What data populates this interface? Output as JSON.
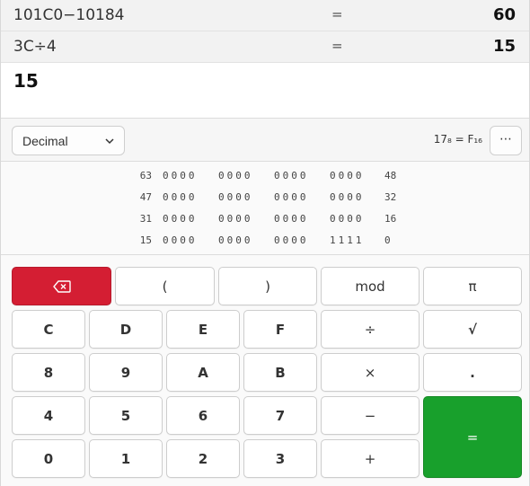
{
  "history": [
    {
      "expression": "101C0−10184",
      "equals": "=",
      "result": "60"
    },
    {
      "expression": "3C÷4",
      "equals": "=",
      "result": "15"
    }
  ],
  "entry": {
    "value": "15"
  },
  "toolbar": {
    "base_mode": "Decimal",
    "conversion": "17₈ = F₁₆",
    "more_label": "⋯"
  },
  "bit_panel": {
    "rows": [
      {
        "high": "63",
        "groups": [
          "0000",
          "0000",
          "0000",
          "0000"
        ],
        "low": "48"
      },
      {
        "high": "47",
        "groups": [
          "0000",
          "0000",
          "0000",
          "0000"
        ],
        "low": "32"
      },
      {
        "high": "31",
        "groups": [
          "0000",
          "0000",
          "0000",
          "0000"
        ],
        "low": "16"
      },
      {
        "high": "15",
        "groups": [
          "0000",
          "0000",
          "0000",
          "1111"
        ],
        "low": "0"
      }
    ]
  },
  "keypad": {
    "backspace_icon": "backspace-icon",
    "open_paren": "(",
    "close_paren": ")",
    "mod": "mod",
    "pi": "π",
    "c": "C",
    "d": "D",
    "e": "E",
    "f": "F",
    "divide": "÷",
    "sqrt": "√",
    "n8": "8",
    "n9": "9",
    "a": "A",
    "b": "B",
    "multiply": "×",
    "point": ".",
    "n4": "4",
    "n5": "5",
    "n6": "6",
    "n7": "7",
    "minus": "−",
    "equals": "=",
    "n0": "0",
    "n1": "1",
    "n2": "2",
    "n3": "3",
    "plus": "+"
  },
  "colors": {
    "backspace": "#d41e33",
    "equals": "#18a02c"
  }
}
